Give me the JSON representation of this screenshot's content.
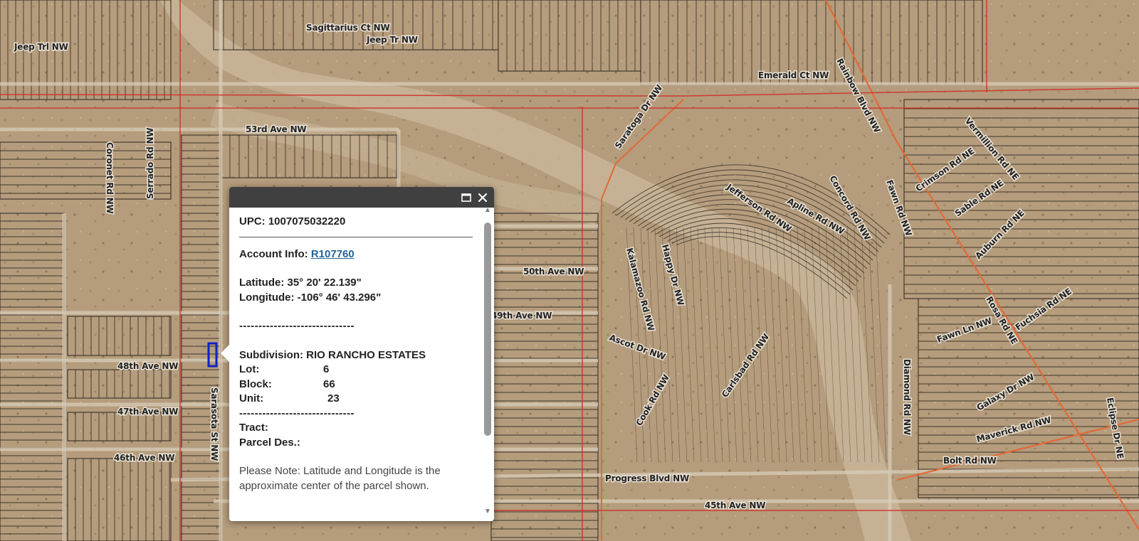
{
  "map": {
    "road_labels": [
      "Jeep Trl NW",
      "Sagittarius Ct NW",
      "Jeep Tr NW",
      "Emerald Ct NW",
      "Rainbow Blvd NW",
      "53rd Ave NW",
      "Saratoga Dr NW",
      "Coronet Rd NW",
      "Serrado Rd NW",
      "Jefferson Rd NW",
      "Apline Rd NW",
      "Concord Rd NW",
      "Fawn Rd NW",
      "Vermillion Rd NE",
      "Crimson Rd NE",
      "Sable Rd NE",
      "Auburn Rd NE",
      "Rosa Rd NE",
      "Fuchsia Rd NE",
      "Fawn Ln NW",
      "50th Ave NW",
      "49th Ave NW",
      "48th Ave NW",
      "47th Ave NW",
      "46th Ave NW",
      "45th Ave NW",
      "Ascot Dr NW",
      "Happy Dr NW",
      "Kalamazoo Rd NW",
      "Sarasota St NW",
      "Diamond Rd NW",
      "Galaxy Dr NW",
      "Maverick Rd NW",
      "Bolt Rd NW",
      "Progress Blvd NW",
      "Cook Rd NW",
      "Carlsbad Rd NW",
      "Eclipse Dr NE"
    ]
  },
  "popup": {
    "upc_label": "UPC:",
    "upc_value": "1007075032220",
    "account_label": "Account Info:",
    "account_value": "R107760",
    "latitude_label": "Latitude:",
    "latitude_value": "35° 20' 22.139\"",
    "longitude_label": "Longitude:",
    "longitude_value": "-106° 46' 43.296\"",
    "dashes": "------------------------------",
    "subdivision_label": "Subdivision:",
    "subdivision_value": "RIO RANCHO ESTATES",
    "lot_label": "Lot:",
    "lot_value": "6",
    "block_label": "Block:",
    "block_value": "66",
    "unit_label": "Unit:",
    "unit_value": "23",
    "tract_label": "Tract:",
    "tract_value": "",
    "parcel_label": "Parcel Des.:",
    "parcel_value": "",
    "note": "Please Note: Latitude and Longitude is the approximate center of the parcel shown."
  },
  "colors": {
    "popup_titlebar": "#404040",
    "link": "#2a6496",
    "selected_parcel": "#1020c8",
    "boundary_red": "#d0302a",
    "road_orange": "#e06a38"
  },
  "icons": {
    "maximize": "maximize-icon",
    "close": "close-icon",
    "scroll_up": "scroll-up-icon",
    "scroll_down": "scroll-down-icon"
  }
}
